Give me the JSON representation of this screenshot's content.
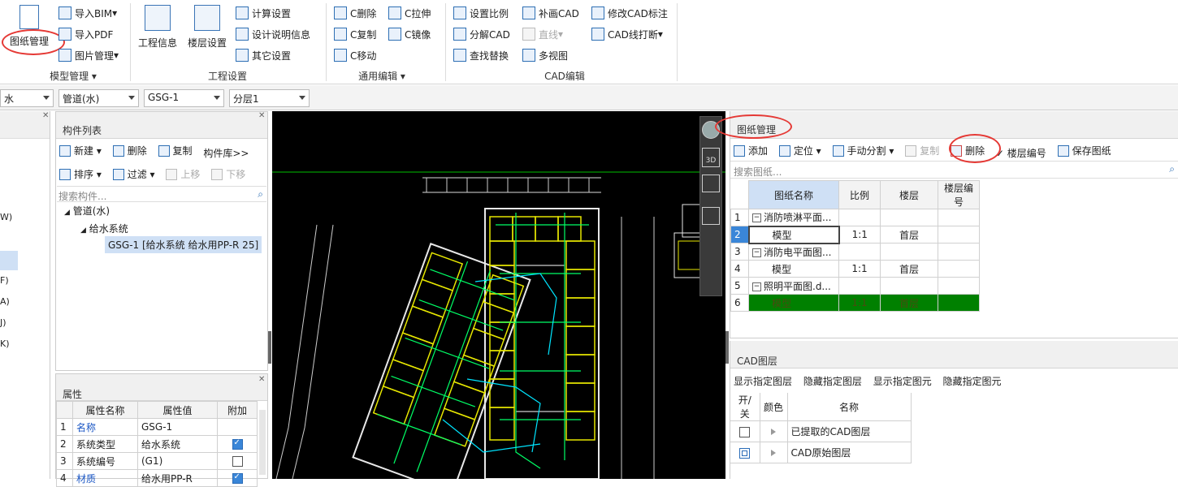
{
  "ribbon": {
    "model": {
      "drawing_mgmt": "图纸管理",
      "import_bim": "导入BIM",
      "import_pdf": "导入PDF",
      "image_mgmt": "图片管理",
      "group": "模型管理"
    },
    "project": {
      "project_info": "工程信息",
      "floor_settings": "楼层设置",
      "calc_settings": "计算设置",
      "design_desc": "设计说明信息",
      "other_settings": "其它设置",
      "group": "工程设置"
    },
    "edit": {
      "c_delete": "C删除",
      "c_copy": "C复制",
      "c_move": "C移动",
      "c_stretch": "C拉伸",
      "c_mirror": "C镜像",
      "group": "通用编辑"
    },
    "cad": {
      "set_scale": "设置比例",
      "explode_cad": "分解CAD",
      "find_replace": "查找替换",
      "complete_cad": "补画CAD",
      "line": "直线",
      "multiview": "多视图",
      "modify_annot": "修改CAD标注",
      "line_break": "CAD线打断",
      "group": "CAD编辑"
    }
  },
  "toolbar": {
    "combo1": "水",
    "combo2": "管道(水)",
    "combo3": "GSG-1",
    "combo4": "分层1"
  },
  "left_strip": {
    "items": [
      "W)",
      "F)",
      "A)",
      "J)",
      "K)"
    ]
  },
  "component_list": {
    "title": "构件列表",
    "new": "新建",
    "delete": "删除",
    "copy": "复制",
    "library": "构件库>>",
    "sort": "排序",
    "filter": "过滤",
    "up": "上移",
    "down": "下移",
    "search_placeholder": "搜索构件...",
    "tree": {
      "root": "管道(水)",
      "child": "给水系统",
      "leaf": "GSG-1 [给水系统 给水用PP-R 25]"
    }
  },
  "properties": {
    "title": "属性",
    "headers": [
      "属性名称",
      "属性值",
      "附加"
    ],
    "rows": [
      {
        "num": "1",
        "name": "名称",
        "value": "GSG-1"
      },
      {
        "num": "2",
        "name": "系统类型",
        "value": "给水系统"
      },
      {
        "num": "3",
        "name": "系统编号",
        "value": "(G1)"
      },
      {
        "num": "4",
        "name": "材质",
        "value": "给水用PP-R"
      }
    ]
  },
  "viewport": {
    "view_3d": "3D"
  },
  "drawing_panel": {
    "title": "图纸管理",
    "add": "添加",
    "locate": "定位",
    "manual_split": "手动分割",
    "copy": "复制",
    "delete": "删除",
    "floor_num": "楼层编号",
    "save": "保存图纸",
    "search_placeholder": "搜索图纸...",
    "headers": [
      "图纸名称",
      "比例",
      "楼层",
      "楼层编号"
    ],
    "rows": [
      {
        "num": "1",
        "name": "消防喷淋平面...",
        "scale": "",
        "floor": ""
      },
      {
        "num": "2",
        "name": "模型",
        "scale": "1:1",
        "floor": "首层"
      },
      {
        "num": "3",
        "name": "消防电平面图...",
        "scale": "",
        "floor": ""
      },
      {
        "num": "4",
        "name": "模型",
        "scale": "1:1",
        "floor": "首层"
      },
      {
        "num": "5",
        "name": "照明平面图.d...",
        "scale": "",
        "floor": ""
      },
      {
        "num": "6",
        "name": "模型",
        "scale": "1:1",
        "floor": "首层"
      }
    ]
  },
  "cad_layers": {
    "title": "CAD图层",
    "show_layer": "显示指定图层",
    "hide_layer": "隐藏指定图层",
    "show_elem": "显示指定图元",
    "hide_elem": "隐藏指定图元",
    "headers": [
      "开/关",
      "颜色",
      "名称"
    ],
    "rows": [
      {
        "name": "已提取的CAD图层"
      },
      {
        "name": "CAD原始图层"
      }
    ]
  },
  "colors": {
    "selected_row": "#008000",
    "highlight": "#cfe0f5",
    "link": "#1a56c4",
    "annotation": "#e53935"
  }
}
